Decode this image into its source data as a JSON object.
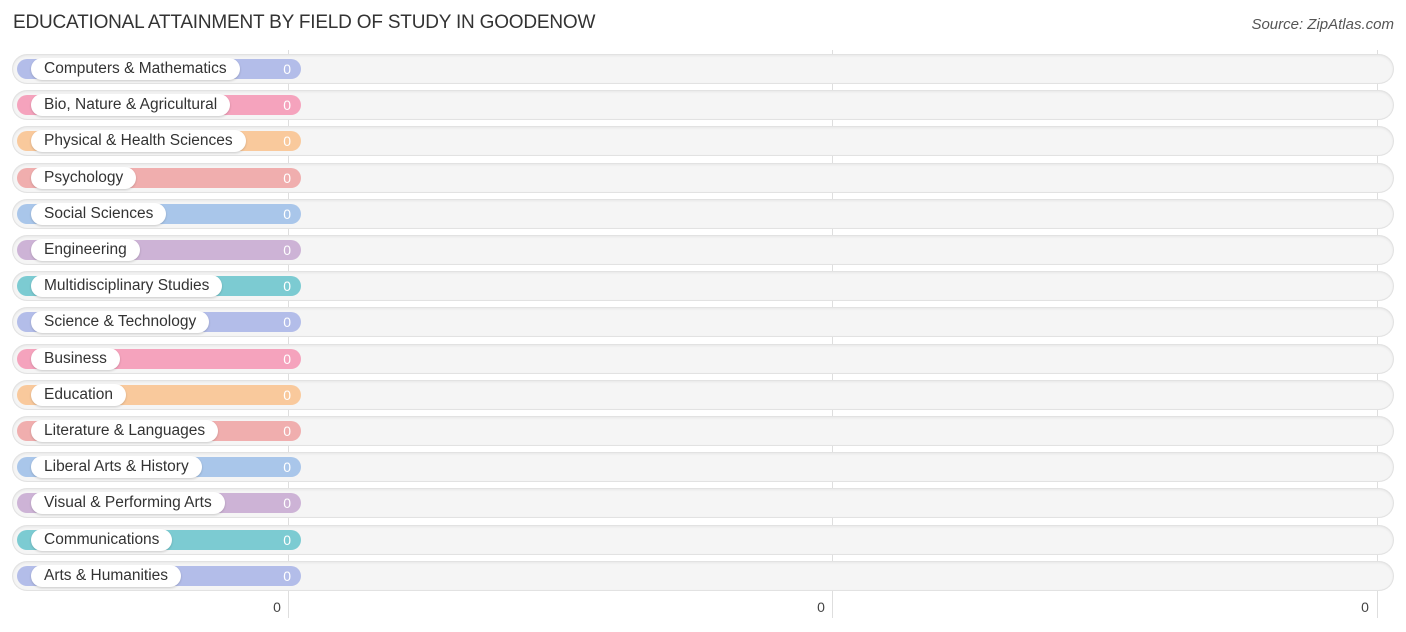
{
  "header": {
    "title": "EDUCATIONAL ATTAINMENT BY FIELD OF STUDY IN GOODENOW",
    "source": "Source: ZipAtlas.com"
  },
  "chart_data": {
    "type": "bar",
    "orientation": "horizontal",
    "title": "EDUCATIONAL ATTAINMENT BY FIELD OF STUDY IN GOODENOW",
    "xlabel": "",
    "ylabel": "",
    "xlim": [
      0,
      0
    ],
    "x_ticks": [
      "0",
      "0",
      "0"
    ],
    "grid": true,
    "legend": "none",
    "categories": [
      "Computers & Mathematics",
      "Bio, Nature & Agricultural",
      "Physical & Health Sciences",
      "Psychology",
      "Social Sciences",
      "Engineering",
      "Multidisciplinary Studies",
      "Science & Technology",
      "Business",
      "Education",
      "Literature & Languages",
      "Liberal Arts & History",
      "Visual & Performing Arts",
      "Communications",
      "Arts & Humanities"
    ],
    "values": [
      0,
      0,
      0,
      0,
      0,
      0,
      0,
      0,
      0,
      0,
      0,
      0,
      0,
      0,
      0
    ],
    "value_labels": [
      "0",
      "0",
      "0",
      "0",
      "0",
      "0",
      "0",
      "0",
      "0",
      "0",
      "0",
      "0",
      "0",
      "0",
      "0"
    ],
    "colors": [
      "#b3bde9",
      "#f5a3bd",
      "#f9c99c",
      "#f0aeae",
      "#a9c6ea",
      "#cdb3d6",
      "#7ccbd2",
      "#b3bde9",
      "#f5a3bd",
      "#f9c99c",
      "#f0aeae",
      "#a9c6ea",
      "#cdb3d6",
      "#7ccbd2",
      "#b3bde9"
    ]
  }
}
